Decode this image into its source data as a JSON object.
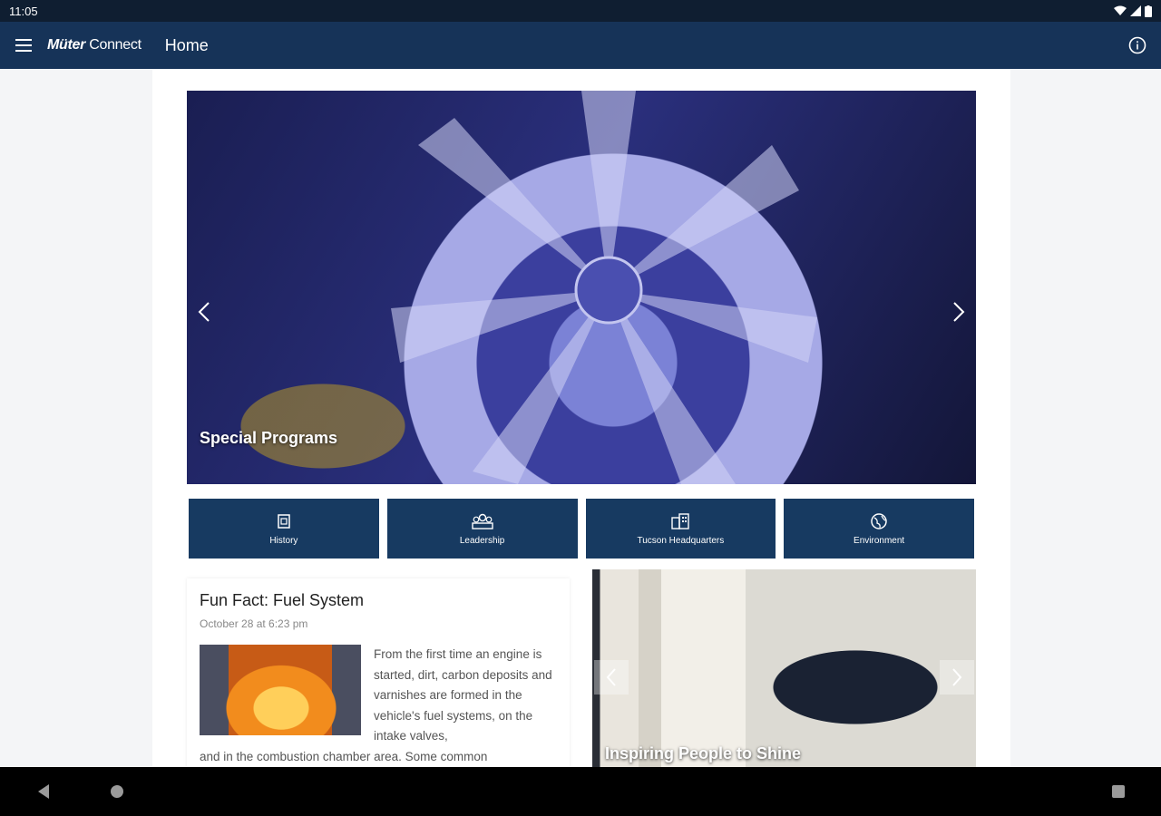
{
  "status_bar": {
    "time": "11:05"
  },
  "app_bar": {
    "brand_bold": "Müter",
    "brand_light": "Connect",
    "title": "Home"
  },
  "hero": {
    "caption": "Special Programs"
  },
  "tiles": [
    {
      "label": "History",
      "icon": "history-icon"
    },
    {
      "label": "Leadership",
      "icon": "leadership-icon"
    },
    {
      "label": "Tucson Headquarters",
      "icon": "building-icon"
    },
    {
      "label": "Environment",
      "icon": "globe-icon"
    }
  ],
  "article": {
    "title": "Fun Fact: Fuel System",
    "date": "October 28 at 6:23 pm",
    "text": "From the first time an engine is started, dirt, carbon deposits and varnishes are formed in the vehicle's fuel systems, on the intake valves,",
    "more": "and in the combustion chamber area. Some common"
  },
  "promo": {
    "caption": "Inspiring People to Shine"
  },
  "colors": {
    "app_bar": "#163358",
    "tile": "#173a61",
    "status_bar": "#0f1e31"
  }
}
